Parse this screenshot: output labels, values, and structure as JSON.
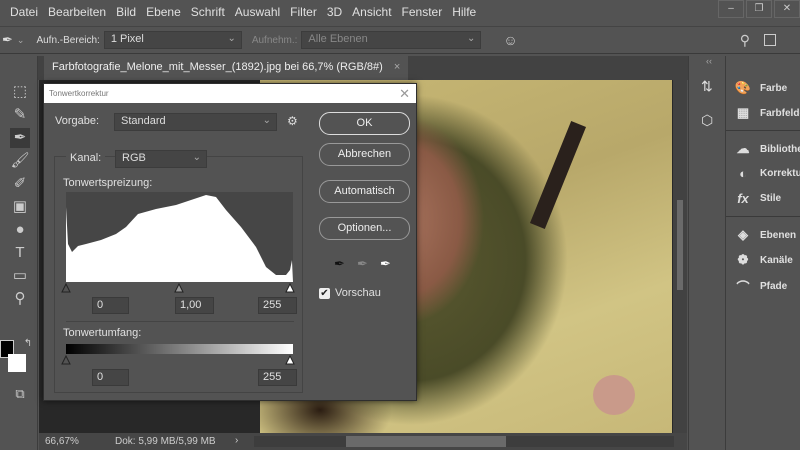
{
  "menu": [
    "Datei",
    "Bearbeiten",
    "Bild",
    "Ebene",
    "Schrift",
    "Auswahl",
    "Filter",
    "3D",
    "Ansicht",
    "Fenster",
    "Hilfe"
  ],
  "window_buttons": [
    "–",
    "❐",
    "✕"
  ],
  "options": {
    "sample_label": "Aufn.-Bereich:",
    "sample_value": "1 Pixel",
    "layers_label": "Aufnehm.:",
    "layers_value": "Alle Ebenen"
  },
  "document_tab": {
    "title": "Farbfotografie_Melone_mit_Messer_(1892).jpg bei 66,7% (RGB/8#)",
    "close": "×"
  },
  "status": {
    "zoom": "66,67%",
    "doc": "Dok: 5,99 MB/5,99 MB"
  },
  "panels": {
    "collapse": "‹‹",
    "groups": [
      [
        "Farbe",
        "Farbfelder"
      ],
      [
        "Bibliotheken",
        "Korrekturen",
        "Stile"
      ],
      [
        "Ebenen",
        "Kanäle",
        "Pfade"
      ]
    ]
  },
  "dialog": {
    "title": "Tonwertkorrektur",
    "close": "✕",
    "preset_label": "Vorgabe:",
    "preset_value": "Standard",
    "channel_label": "Kanal:",
    "channel_value": "RGB",
    "input_label": "Tonwertspreizung:",
    "input_black": "0",
    "input_gamma": "1,00",
    "input_white": "255",
    "output_label": "Tonwertumfang:",
    "output_black": "0",
    "output_white": "255",
    "buttons": {
      "ok": "OK",
      "cancel": "Abbrechen",
      "auto": "Automatisch",
      "options": "Optionen..."
    },
    "preview_label": "Vorschau",
    "preview_checked": true
  }
}
